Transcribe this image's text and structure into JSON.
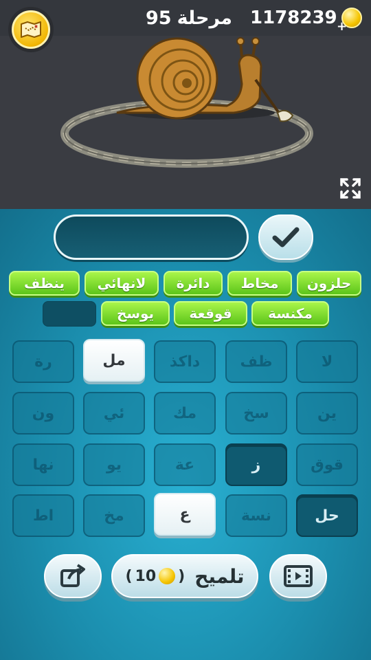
{
  "header": {
    "level_label": "مرحلة",
    "level_number": "95",
    "coins": "1178239"
  },
  "found_words": [
    {
      "text": "حلزون"
    },
    {
      "text": "مخاط"
    },
    {
      "text": "دائرة"
    },
    {
      "text": "لانهائي"
    },
    {
      "text": "ينظف"
    },
    {
      "text": "مكنسة"
    },
    {
      "text": "قوقعة"
    },
    {
      "text": "يوسخ"
    }
  ],
  "tiles": [
    [
      "رة",
      "مل",
      "داكذ",
      "ظف",
      "لا"
    ],
    [
      "ون",
      "ئي",
      "مك",
      "سخ",
      "ين"
    ],
    [
      "نها",
      "يو",
      "عة",
      "ز",
      "قوق"
    ],
    [
      "اط",
      "مخ",
      "ع",
      "نسة",
      "حل"
    ]
  ],
  "tile_states": [
    [
      "dim",
      "active",
      "dim",
      "dim",
      "dim"
    ],
    [
      "dim",
      "dim",
      "dim",
      "dim",
      "dim"
    ],
    [
      "dim",
      "dim",
      "dim",
      "pressed",
      "dim"
    ],
    [
      "dim",
      "dim",
      "active",
      "dim",
      "pressed"
    ]
  ],
  "hint": {
    "label": "تلميح",
    "cost": "10"
  },
  "colors": {
    "found_green": "#7ed82e",
    "panel_blue": "#1b8eae",
    "coin_gold": "#f5c400"
  }
}
